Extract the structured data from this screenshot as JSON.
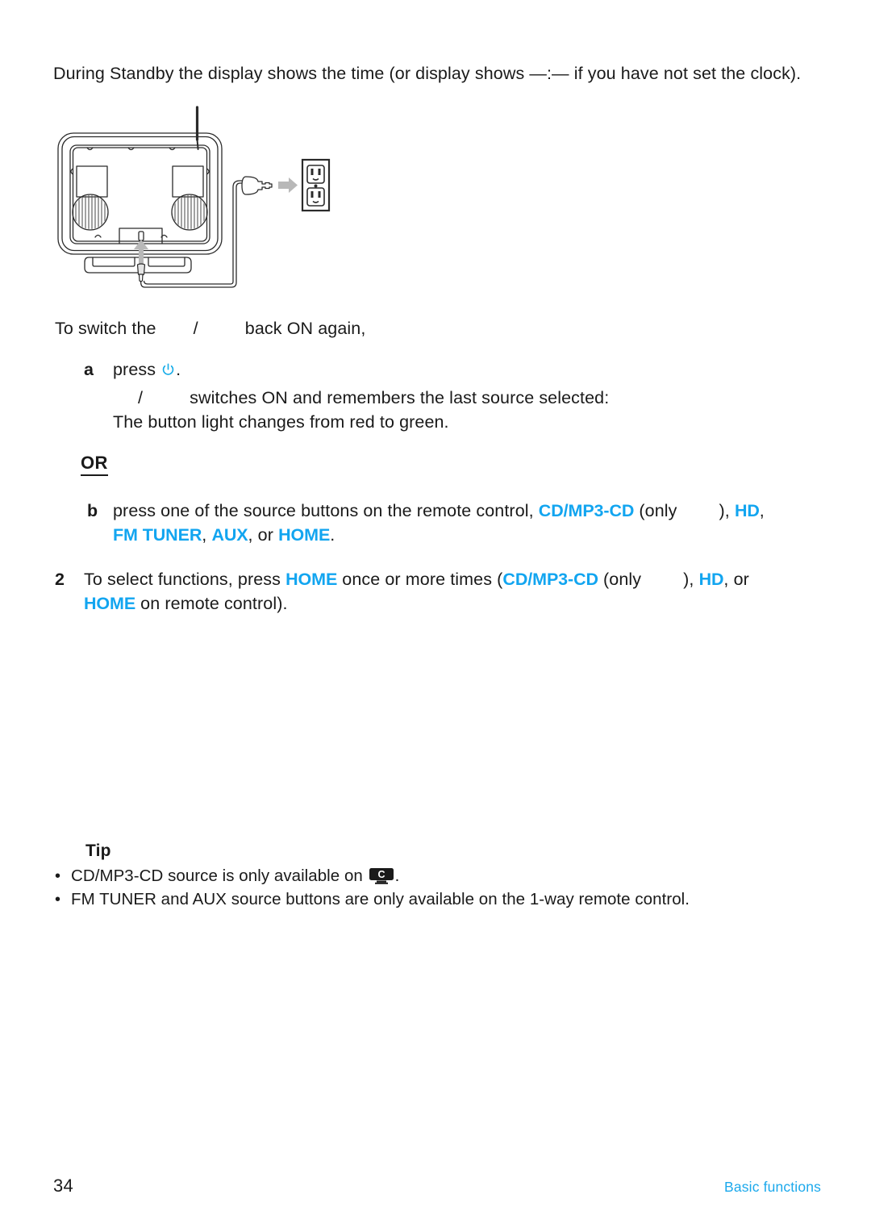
{
  "document": {
    "intro_paragraph": "During Standby the display shows the time (or display shows —:— if you have not set the clock)."
  },
  "figure": {
    "caption": "",
    "alt_name": "rear view of audio station connected by power cable to wall outlet",
    "parts": {
      "antenna": "antenna",
      "speaker_left": "left speaker grille",
      "speaker_right": "right speaker grille",
      "dc_jack": "DC power input jack",
      "power_plug": "power plug",
      "wall_outlet": "wall outlet",
      "stand": "base stand"
    },
    "colors": {
      "outline": "#2b2b2b",
      "arrow": "#b3b3b3",
      "shade": "#d9d9d9"
    }
  },
  "instructions": {
    "to_switch_prefix": "To switch the ",
    "to_switch_slash": "/",
    "to_switch_suffix": " back ON again,",
    "step_a": {
      "marker": "a",
      "text_before_icon": "press ",
      "power_icon": "power-icon",
      "text_after_icon": ".",
      "detail_line_slash": "/",
      "detail_line_rest": " switches ON and remembers the last source selected:",
      "detail_line_2": "The button light changes from red to green."
    },
    "or_label": "OR",
    "step_b": {
      "marker": "b",
      "part1": "press one of the source buttons on the remote control, ",
      "cd_mp3_cd": "CD/MP3-CD",
      "part2": " (only",
      "part3": "), ",
      "hd": "HD",
      "part4": ",",
      "fm_tuner": "FM TUNER",
      "part5": ", ",
      "aux": "AUX",
      "part6": ", or ",
      "home": "HOME",
      "part7": "."
    },
    "step_2": {
      "marker": "2",
      "part1": "To select functions, press ",
      "home_1": "HOME",
      "part2": " once or more times (",
      "cd_mp3_cd": "CD/MP3-CD",
      "part3": " (only",
      "part4": "), ",
      "hd": "HD",
      "part5": ", or ",
      "home_2": "HOME",
      "part6": " on remote control)."
    }
  },
  "tip": {
    "title": "Tip",
    "bullet_glyph": "•",
    "items": [
      {
        "text_before_badge": "CD/MP3-CD source is only available on ",
        "badge_icon": "device-c-badge-icon",
        "badge_letter": "C",
        "text_after_badge": "."
      },
      {
        "text_before_badge": "FM TUNER and AUX source buttons are only available on the 1-way remote control.",
        "badge_icon": "",
        "badge_letter": "",
        "text_after_badge": ""
      }
    ]
  },
  "footer": {
    "page_number": "34",
    "section_label": "Basic functions"
  },
  "colors": {
    "accent_blue": "#12A5F0",
    "footer_blue": "#1CA9EC",
    "text": "#1a1a1a"
  }
}
